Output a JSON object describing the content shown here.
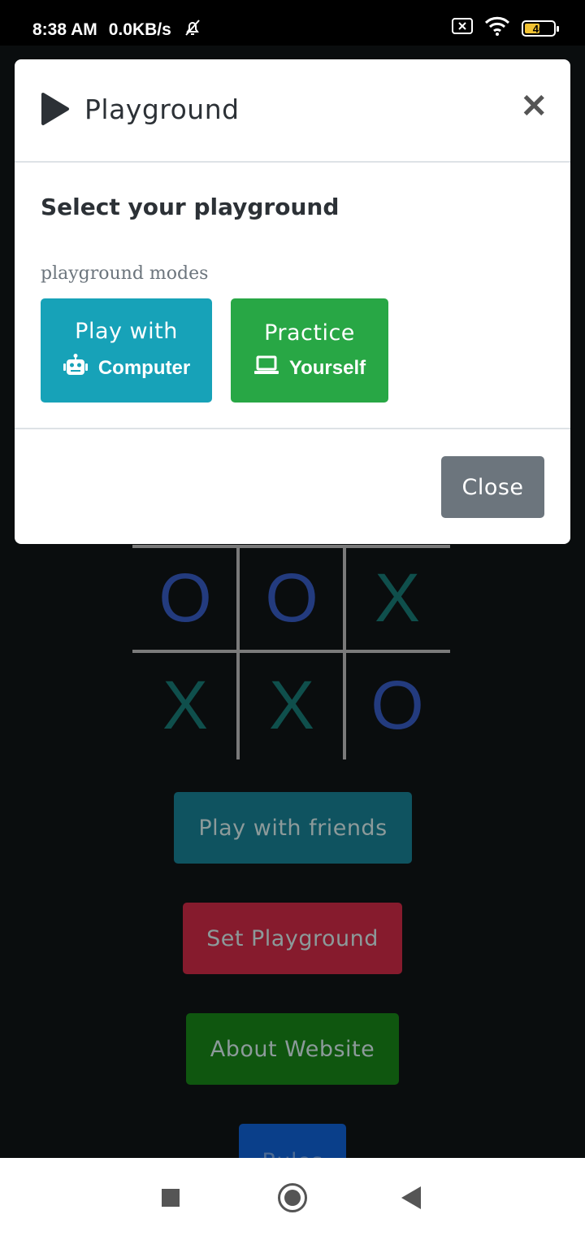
{
  "status_bar": {
    "time": "8:38 AM",
    "net_speed": "0.0KB/s",
    "battery": "46",
    "icons": [
      "mute-bell-icon",
      "sim-x-icon",
      "wifi-icon",
      "battery-icon"
    ]
  },
  "modal": {
    "title": "Playground",
    "heading": "Select your playground",
    "modes_label": "playground modes",
    "mode_computer": {
      "line1": "Play with",
      "line2": "Computer",
      "icon": "robot-icon",
      "color": "#17a2b8"
    },
    "mode_yourself": {
      "line1": "Practice",
      "line2": "Yourself",
      "icon": "laptop-icon",
      "color": "#28a745"
    },
    "close_label": "Close",
    "close_color": "#6c757d"
  },
  "background_page": {
    "board": [
      [
        "O",
        "O",
        "X"
      ],
      [
        "X",
        "X",
        "O"
      ]
    ],
    "buttons": {
      "play_friends": "Play with friends",
      "set_playground": "Set Playground",
      "about_website": "About Website",
      "rules": "Rules"
    }
  },
  "navbar": {
    "icons": [
      "recents-square-icon",
      "home-circle-icon",
      "back-triangle-icon"
    ]
  }
}
